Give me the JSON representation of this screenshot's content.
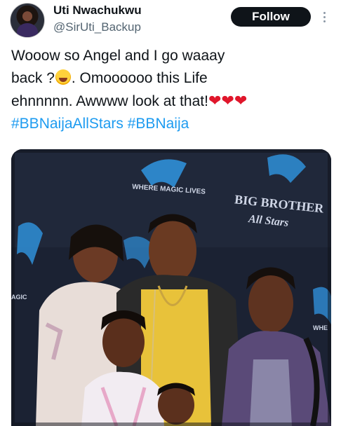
{
  "author": {
    "display_name": "Uti Nwachukwu",
    "handle": "@SirUti_Backup"
  },
  "follow_label": "Follow",
  "tweet": {
    "line1": "Wooow so Angel and I go waaay",
    "line2_before_emoji": "back ?",
    "line2_after_emoji": ". Omoooooo this Life",
    "line3": "ehnnnnn. Awwww look at that!",
    "hearts": "❤❤❤",
    "hashtags": [
      "#BBNaijaAllStars",
      "#BBNaija"
    ]
  },
  "photo": {
    "backdrop_text": {
      "where": "WHERE MAGIC LIVES",
      "brand_line1": "BIG BROTHER",
      "brand_line2": "All Stars",
      "left_edge": "AGIC",
      "right_edge": "WHE"
    }
  },
  "icons": {
    "more": "more-vertical-icon",
    "laugh": "rolling-laughing-emoji-icon",
    "heart": "red-heart-icon"
  },
  "colors": {
    "follow_bg": "#0f1419",
    "hashtag": "#1d9bf0",
    "handle": "#536471",
    "heart": "#e0162b"
  }
}
